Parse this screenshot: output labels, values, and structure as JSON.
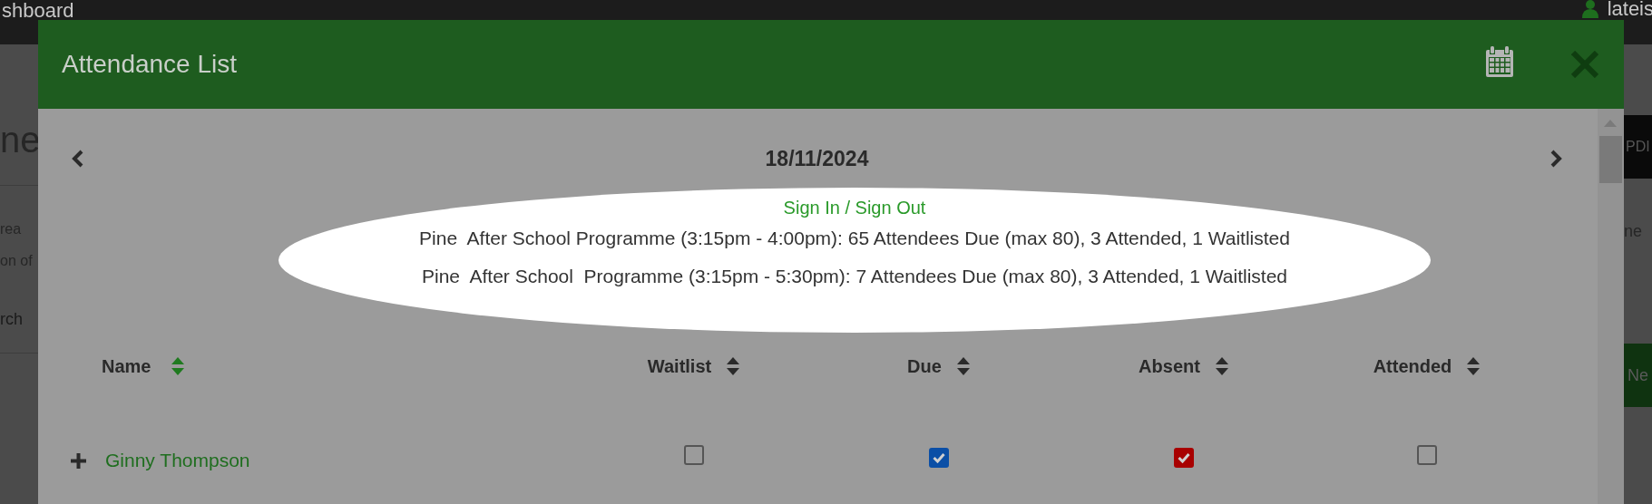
{
  "background_page": {
    "top_bar": {
      "title": "shboard",
      "user": "lateis"
    },
    "left_edge": {
      "heading": "ne",
      "text_lines": [
        "rea",
        "on of"
      ],
      "search_placeholder": "rch"
    },
    "right_edge": {
      "pdf_button": "PDI",
      "text": "ne",
      "new_button": "Ne"
    }
  },
  "modal": {
    "title": "Attendance List",
    "date": "18/11/2024",
    "summary": {
      "link": "Sign In / Sign Out",
      "lines": [
        "Pine  After School Programme (3:15pm - 4:00pm): 65 Attendees Due (max 80), 3 Attended, 1 Waitlisted",
        "Pine  After School  Programme (3:15pm - 5:30pm): 7 Attendees Due (max 80), 3 Attended, 1 Waitlisted"
      ]
    },
    "table": {
      "columns": [
        {
          "label": "Name",
          "kind": "name",
          "sorted": true
        },
        {
          "label": "Waitlist",
          "kind": "check",
          "sorted": false
        },
        {
          "label": "Due",
          "kind": "check",
          "sorted": false
        },
        {
          "label": "Absent",
          "kind": "check",
          "sorted": false
        },
        {
          "label": "Attended",
          "kind": "check",
          "sorted": false
        }
      ],
      "rows": [
        {
          "name": "Ginny Thompson",
          "cells": [
            {
              "checked": false
            },
            {
              "checked": true,
              "color": "#0b4fa6"
            },
            {
              "checked": true,
              "color": "#a80000"
            },
            {
              "checked": false
            }
          ]
        }
      ]
    }
  }
}
